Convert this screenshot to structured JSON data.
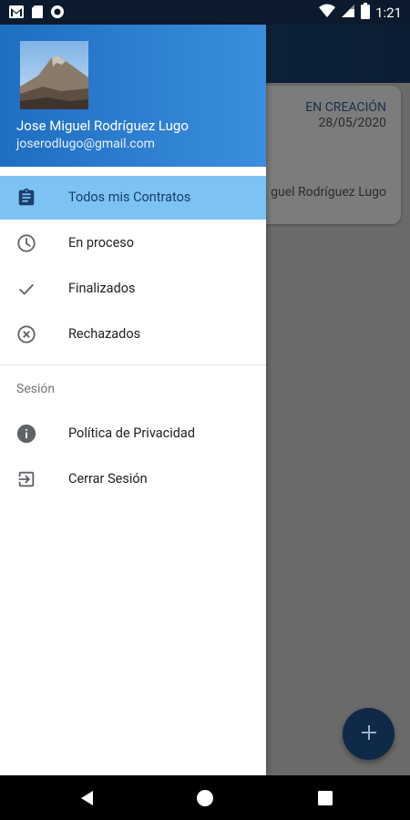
{
  "status_bar": {
    "time": "1:21",
    "left_icons": [
      "gmail-icon",
      "sd-card-icon",
      "circle-notification-icon"
    ],
    "right_icons": [
      "wifi-icon",
      "signal-icon",
      "battery-icon"
    ]
  },
  "background": {
    "card": {
      "status": "EN CREACIÓN",
      "date": "28/05/2020",
      "name": "guel Rodríguez Lugo"
    },
    "fab_label": "+"
  },
  "drawer": {
    "user": {
      "name": "Jose Miguel Rodríguez Lugo",
      "email": "joserodlugo@gmail.com"
    },
    "items": [
      {
        "label": "Todos mis Contratos",
        "icon": "clipboard-icon",
        "selected": true
      },
      {
        "label": "En proceso",
        "icon": "clock-icon",
        "selected": false
      },
      {
        "label": "Finalizados",
        "icon": "check-icon",
        "selected": false
      },
      {
        "label": "Rechazados",
        "icon": "cancel-circle-icon",
        "selected": false
      }
    ],
    "section_title": "Sesión",
    "session_items": [
      {
        "label": "Política de Privacidad",
        "icon": "info-icon"
      },
      {
        "label": "Cerrar Sesión",
        "icon": "logout-icon"
      }
    ]
  },
  "colors": {
    "selected_bg": "#7cc3f4",
    "header_gradient_start": "#1e6ec1",
    "header_gradient_end": "#3b8ede",
    "icon_color": "#5f6368"
  }
}
